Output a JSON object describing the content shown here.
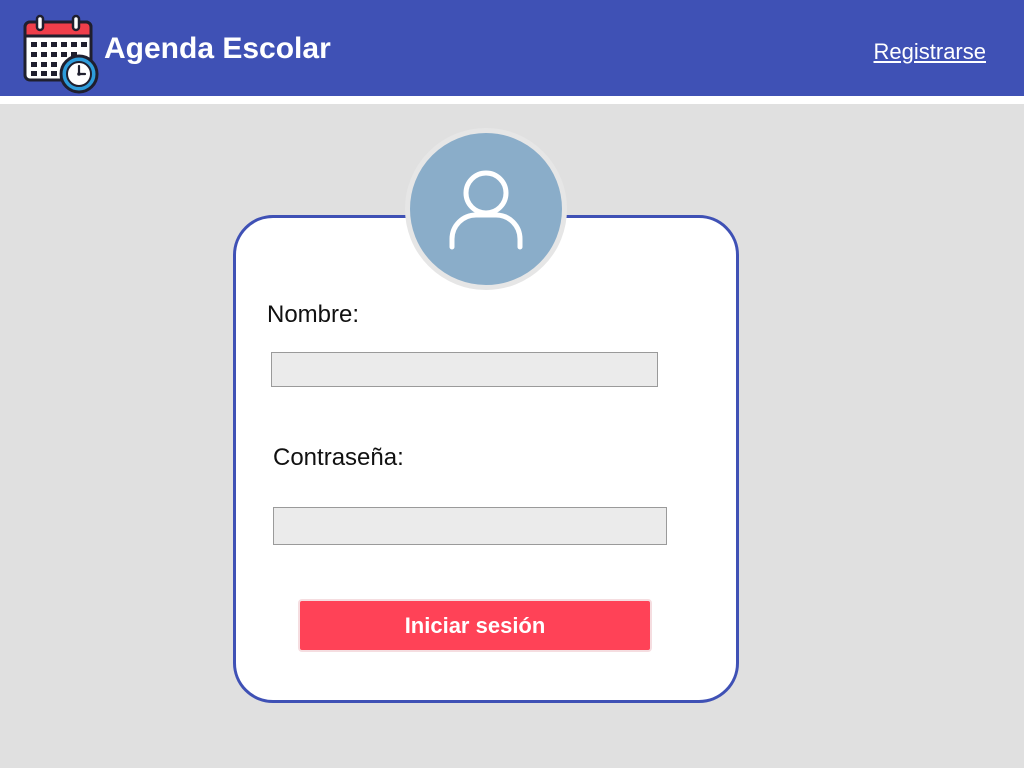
{
  "header": {
    "title": "Agenda Escolar",
    "register_link": "Registrarse",
    "logo_icon": "calendar-clock-icon"
  },
  "login": {
    "avatar_icon": "user-icon",
    "name_label": "Nombre:",
    "name_value": "",
    "password_label": "Contraseña:",
    "password_value": "",
    "submit_label": "Iniciar sesión"
  },
  "colors": {
    "header_bg": "#3f51b5",
    "page_bg": "#e0e0e0",
    "card_border": "#3f51b5",
    "avatar_bg": "#8aadc9",
    "button_bg": "#ff4257",
    "calendar_top": "#ef3e4a",
    "clock_face": "#2d9cdb"
  }
}
